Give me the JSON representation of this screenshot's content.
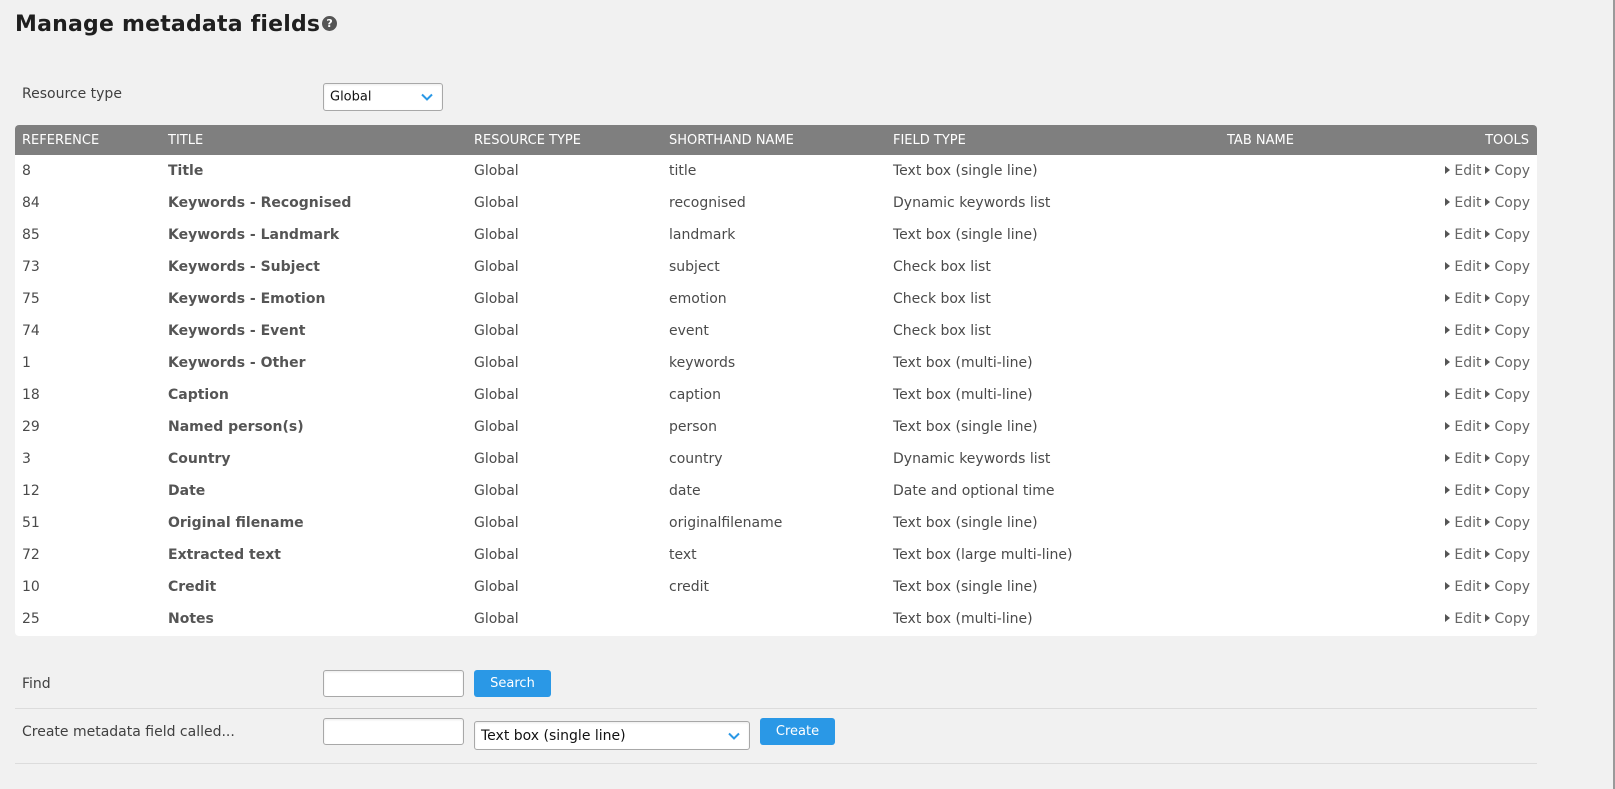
{
  "page": {
    "title": "Manage metadata fields"
  },
  "resource_type": {
    "label": "Resource type",
    "selected": "Global"
  },
  "table": {
    "headers": {
      "reference": "REFERENCE",
      "title": "TITLE",
      "resource_type": "RESOURCE TYPE",
      "shorthand": "SHORTHAND NAME",
      "field_type": "FIELD TYPE",
      "tab_name": "TAB NAME",
      "tools": "TOOLS"
    },
    "tool_labels": {
      "edit": "Edit",
      "copy": "Copy"
    },
    "rows": [
      {
        "ref": "8",
        "title": "Title",
        "resource_type": "Global",
        "shorthand": "title",
        "field_type": "Text box (single line)",
        "tab": ""
      },
      {
        "ref": "84",
        "title": "Keywords - Recognised",
        "resource_type": "Global",
        "shorthand": "recognised",
        "field_type": "Dynamic keywords list",
        "tab": ""
      },
      {
        "ref": "85",
        "title": "Keywords - Landmark",
        "resource_type": "Global",
        "shorthand": "landmark",
        "field_type": "Text box (single line)",
        "tab": ""
      },
      {
        "ref": "73",
        "title": "Keywords - Subject",
        "resource_type": "Global",
        "shorthand": "subject",
        "field_type": "Check box list",
        "tab": ""
      },
      {
        "ref": "75",
        "title": "Keywords - Emotion",
        "resource_type": "Global",
        "shorthand": "emotion",
        "field_type": "Check box list",
        "tab": ""
      },
      {
        "ref": "74",
        "title": "Keywords - Event",
        "resource_type": "Global",
        "shorthand": "event",
        "field_type": "Check box list",
        "tab": ""
      },
      {
        "ref": "1",
        "title": "Keywords - Other",
        "resource_type": "Global",
        "shorthand": "keywords",
        "field_type": "Text box (multi-line)",
        "tab": ""
      },
      {
        "ref": "18",
        "title": "Caption",
        "resource_type": "Global",
        "shorthand": "caption",
        "field_type": "Text box (multi-line)",
        "tab": ""
      },
      {
        "ref": "29",
        "title": "Named person(s)",
        "resource_type": "Global",
        "shorthand": "person",
        "field_type": "Text box (single line)",
        "tab": ""
      },
      {
        "ref": "3",
        "title": "Country",
        "resource_type": "Global",
        "shorthand": "country",
        "field_type": "Dynamic keywords list",
        "tab": ""
      },
      {
        "ref": "12",
        "title": "Date",
        "resource_type": "Global",
        "shorthand": "date",
        "field_type": "Date and optional time",
        "tab": ""
      },
      {
        "ref": "51",
        "title": "Original filename",
        "resource_type": "Global",
        "shorthand": "originalfilename",
        "field_type": "Text box (single line)",
        "tab": ""
      },
      {
        "ref": "72",
        "title": "Extracted text",
        "resource_type": "Global",
        "shorthand": "text",
        "field_type": "Text box (large multi-line)",
        "tab": ""
      },
      {
        "ref": "10",
        "title": "Credit",
        "resource_type": "Global",
        "shorthand": "credit",
        "field_type": "Text box (single line)",
        "tab": ""
      },
      {
        "ref": "25",
        "title": "Notes",
        "resource_type": "Global",
        "shorthand": "",
        "field_type": "Text box (multi-line)",
        "tab": ""
      }
    ]
  },
  "find": {
    "label": "Find",
    "value": "",
    "button": "Search"
  },
  "create": {
    "label": "Create metadata field called...",
    "value": "",
    "type_selected": "Text box (single line)",
    "button": "Create"
  },
  "colors": {
    "accent": "#2a98e6",
    "header_bg": "#7f7f7f",
    "page_bg": "#f1f1f1"
  },
  "icons": {
    "help": "question-circle-icon",
    "dropdown": "chevron-down-icon",
    "tool": "caret-right-icon"
  }
}
